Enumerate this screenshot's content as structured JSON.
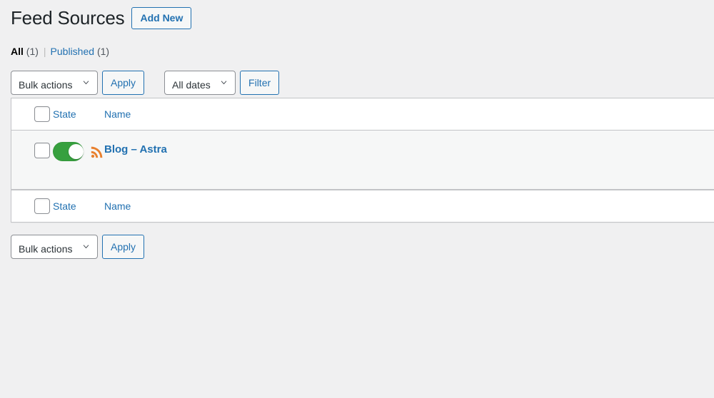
{
  "page": {
    "title": "Feed Sources",
    "add_new_label": "Add New"
  },
  "filters": {
    "all_label": "All",
    "all_count": "(1)",
    "separator": "|",
    "published_label": "Published",
    "published_count": "(1)"
  },
  "tablenav_top": {
    "bulk_actions_selected": "Bulk actions",
    "bulk_actions_options": [
      "Bulk actions"
    ],
    "apply_label": "Apply",
    "dates_selected": "All dates",
    "dates_options": [
      "All dates"
    ],
    "filter_label": "Filter"
  },
  "tablenav_bottom": {
    "bulk_actions_selected": "Bulk actions",
    "bulk_actions_options": [
      "Bulk actions"
    ],
    "apply_label": "Apply"
  },
  "table": {
    "columns": {
      "state": "State",
      "name": "Name"
    },
    "rows": [
      {
        "state_enabled": true,
        "name": "Blog – Astra",
        "icon": "rss-icon"
      }
    ]
  },
  "colors": {
    "page_background": "#f0f0f1",
    "link": "#2271b1",
    "toggle_on": "#37a03f",
    "rss_orange": "#e8802e",
    "row_background": "#f6f7f7",
    "border": "#c3c4c7",
    "title_text": "#1d2327"
  }
}
